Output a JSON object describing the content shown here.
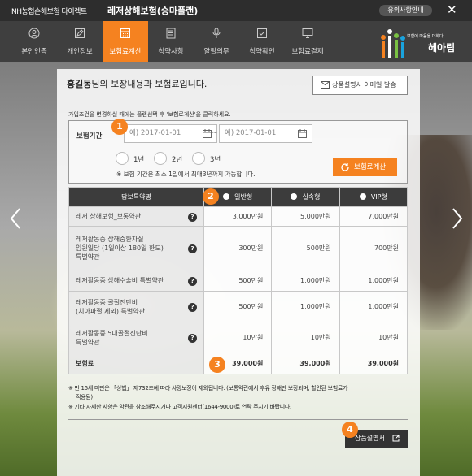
{
  "topbar": {
    "brand": "NH농협손해보험 다이렉트",
    "title": "레저상해보험(승마플랜)",
    "notice_button": "유의사항안내",
    "close_icon": "close-icon"
  },
  "nav": {
    "items": [
      {
        "label": "본인인증",
        "icon": "person-icon"
      },
      {
        "label": "개인정보",
        "icon": "edit-icon"
      },
      {
        "label": "보험료계산",
        "icon": "calculator-icon",
        "active": true
      },
      {
        "label": "청약사항",
        "icon": "document-icon"
      },
      {
        "label": "알릴의무",
        "icon": "microphone-icon"
      },
      {
        "label": "청약확인",
        "icon": "checkbox-icon"
      },
      {
        "label": "보험료결제",
        "icon": "monitor-icon"
      }
    ],
    "logo": {
      "tagline": "보험에 마음을 더하다.",
      "name": "헤아림"
    },
    "accent_color": "#f58220"
  },
  "content": {
    "greeting_name": "홍길동",
    "greeting_rest": "님의 보장내용과 보험료입니다.",
    "email_button": "상품설명서 이메일 발송",
    "instruction": "가입조건을 변경하실 때에는 플랜선택 후 '보험료계산'을 클릭하세요.",
    "period": {
      "label": "보험기간",
      "start_placeholder": "예) 2017-01-01",
      "end_placeholder": "예) 2017-01-01",
      "options": [
        "1년",
        "2년",
        "3년"
      ],
      "note": "※ 보험 기간은 최소 1일에서 최대3년까지 가능합니다.",
      "calc_button": "보험료계산"
    },
    "table": {
      "header": "담보특약명",
      "plans": [
        "일반형",
        "실속형",
        "VIP형"
      ],
      "rows": [
        {
          "name": "레저 상해보험_보통약관",
          "values": [
            "3,000만원",
            "5,000만원",
            "7,000만원"
          ]
        },
        {
          "name_lines": [
            "레저활동중 상해중환자실",
            "입원일당 (1일이상 180일 한도)",
            "특별약관"
          ],
          "values": [
            "300만원",
            "500만원",
            "700만원"
          ]
        },
        {
          "name": "레저활동중 상해수술비 특별약관",
          "values": [
            "500만원",
            "1,000만원",
            "1,000만원"
          ]
        },
        {
          "name_lines": [
            "레저활동중 골절진단비",
            "(치아파절 제외) 특별약관"
          ],
          "values": [
            "500만원",
            "1,000만원",
            "1,000만원"
          ]
        },
        {
          "name_lines": [
            "레저활동중 5대골절진단비",
            "특별약관"
          ],
          "values": [
            "10만원",
            "10만원",
            "10만원"
          ]
        }
      ],
      "total": {
        "name": "보험료",
        "values": [
          "39,000원",
          "39,000원",
          "39,000원"
        ]
      }
    },
    "footnotes": [
      "※ 만 15세 미만은 「상법」 제732조에 따라 사망보장이 제외됩니다. (보통약관에서 후유 장해만 보장되며, 할인된 보험료가",
      "적용됨)",
      "※ 기타 자세한 사항은 약관을 참조해주시거나 고객지원센터(1644-9000)로 연락 주시기 바랍니다."
    ],
    "product_button": "상품설명서"
  },
  "badges": [
    "1",
    "2",
    "3",
    "4"
  ]
}
